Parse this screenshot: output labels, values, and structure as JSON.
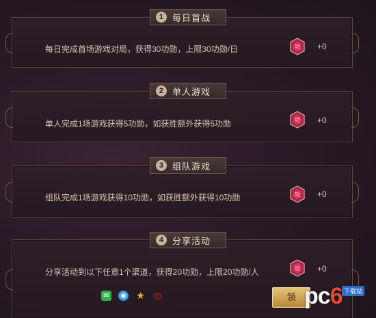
{
  "sections": [
    {
      "num": "1",
      "title": "每日首战",
      "desc": "每日完成首场游戏对局，获得30功勋，上限30功勋/日",
      "value": "+0"
    },
    {
      "num": "2",
      "title": "单人游戏",
      "desc": "单人完成1场游戏获得5功勋，如获胜额外获得5功勋",
      "value": "+0"
    },
    {
      "num": "3",
      "title": "组队游戏",
      "desc": "组队完成1场游戏获得10功勋，如获胜额外获得10功勋",
      "value": "+0"
    },
    {
      "num": "4",
      "title": "分享活动",
      "desc": "分享活动到以下任意1个渠道，获得20功勋，上限20功勋/人",
      "value": "+0"
    }
  ],
  "share_icons": [
    "wechat-icon",
    "qq-icon",
    "qzone-star-icon",
    "weibo-icon"
  ],
  "claim_label": "领",
  "watermark": {
    "brand_pc": "pc",
    "brand_6": "6",
    "brand_tag": "下载站"
  },
  "colors": {
    "accent_gold": "#c8b49a",
    "badge_pink": "#d6305a",
    "background": "#2a1a26"
  }
}
